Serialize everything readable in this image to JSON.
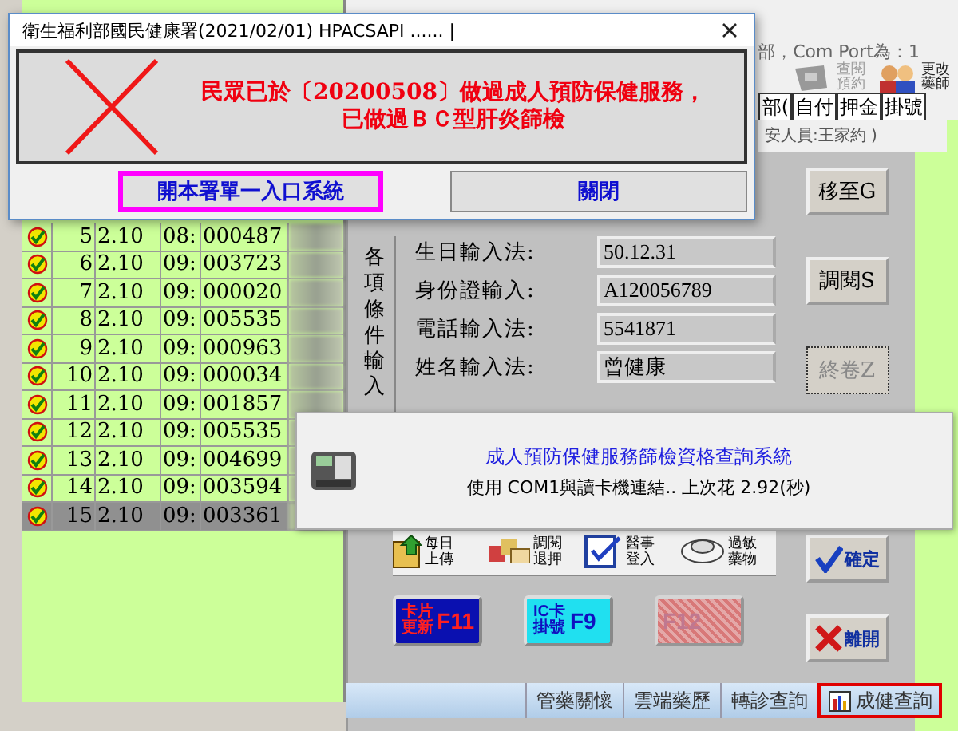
{
  "com_port": "部，Com Port為：1",
  "toolbar": [
    {
      "label": "查閱預約",
      "disabled": true
    },
    {
      "label": "更改藥師",
      "disabled": false
    }
  ],
  "header_columns": [
    "部(",
    "自付",
    "押金",
    "掛號"
  ],
  "staff_note": "安人員:王家約 )",
  "rows": [
    {
      "no": "5",
      "date": "2.10",
      "time": "08:",
      "id": "000487",
      "selected": false
    },
    {
      "no": "6",
      "date": "2.10",
      "time": "09:",
      "id": "003723",
      "selected": false
    },
    {
      "no": "7",
      "date": "2.10",
      "time": "09:",
      "id": "000020",
      "selected": false
    },
    {
      "no": "8",
      "date": "2.10",
      "time": "09:",
      "id": "005535",
      "selected": false
    },
    {
      "no": "9",
      "date": "2.10",
      "time": "09:",
      "id": "000963",
      "selected": false
    },
    {
      "no": "10",
      "date": "2.10",
      "time": "09:",
      "id": "000034",
      "selected": false
    },
    {
      "no": "11",
      "date": "2.10",
      "time": "09:",
      "id": "001857",
      "selected": false
    },
    {
      "no": "12",
      "date": "2.10",
      "time": "09:",
      "id": "005535",
      "selected": false
    },
    {
      "no": "13",
      "date": "2.10",
      "time": "09:",
      "id": "004699",
      "selected": false
    },
    {
      "no": "14",
      "date": "2.10",
      "time": "09:",
      "id": "003594",
      "selected": false
    },
    {
      "no": "15",
      "date": "2.10",
      "time": "09:",
      "id": "003361",
      "selected": true
    }
  ],
  "search_label": "各項條件輸入",
  "fields": [
    {
      "label": "生日輸入法:",
      "value": "50.12.31"
    },
    {
      "label": "身份證輸入:",
      "value": "A120056789"
    },
    {
      "label": "電話輸入法:",
      "value": "5541871"
    },
    {
      "label": "姓名輸入法:",
      "value": "曾健康"
    }
  ],
  "side_buttons": [
    {
      "label": "移至G",
      "kind": "text",
      "disabled": false
    },
    {
      "label": "調閱S",
      "kind": "text",
      "disabled": false
    },
    {
      "label": "終卷Z",
      "kind": "text",
      "disabled": true
    },
    {
      "label": "確定",
      "kind": "confirm",
      "disabled": false
    },
    {
      "label": "離開",
      "kind": "exit",
      "disabled": false
    }
  ],
  "functions": [
    {
      "label": "每日上傳",
      "kind": "upload"
    },
    {
      "label": "調閱退押",
      "kind": "refund"
    },
    {
      "label": "醫事登入",
      "kind": "login"
    },
    {
      "label": "過敏藥物",
      "kind": "allergy"
    }
  ],
  "fkeys": [
    {
      "label": "卡片更新",
      "key": "F11",
      "kind": "update",
      "disabled": false
    },
    {
      "label": "IC卡掛號",
      "key": "F9",
      "kind": "register",
      "disabled": false
    },
    {
      "key": "F12",
      "kind": "cancel",
      "disabled": true
    }
  ],
  "tabs": [
    {
      "label": "管藥關懷",
      "selected": false
    },
    {
      "label": "雲端藥歷",
      "selected": false
    },
    {
      "label": "轉診查詢",
      "selected": false
    },
    {
      "label": "成健查詢",
      "selected": true
    }
  ],
  "dialog": {
    "title": "衛生福利部國民健康署(2021/02/01) HPACSAPI ...... |",
    "message": [
      "民眾已於〔20200508〕做過成人預防保健服務，",
      "已做過ＢＣ型肝炎篩檢"
    ],
    "buttons": [
      {
        "label": "開本署單一入口系統",
        "highlighted": true
      },
      {
        "label": "關閉",
        "highlighted": false
      }
    ]
  },
  "toast": {
    "title": "成人預防保健服務篩檢資格查詢系統",
    "message": "使用 COM1與讀卡機連結.. 上次花  2.92(秒)"
  }
}
